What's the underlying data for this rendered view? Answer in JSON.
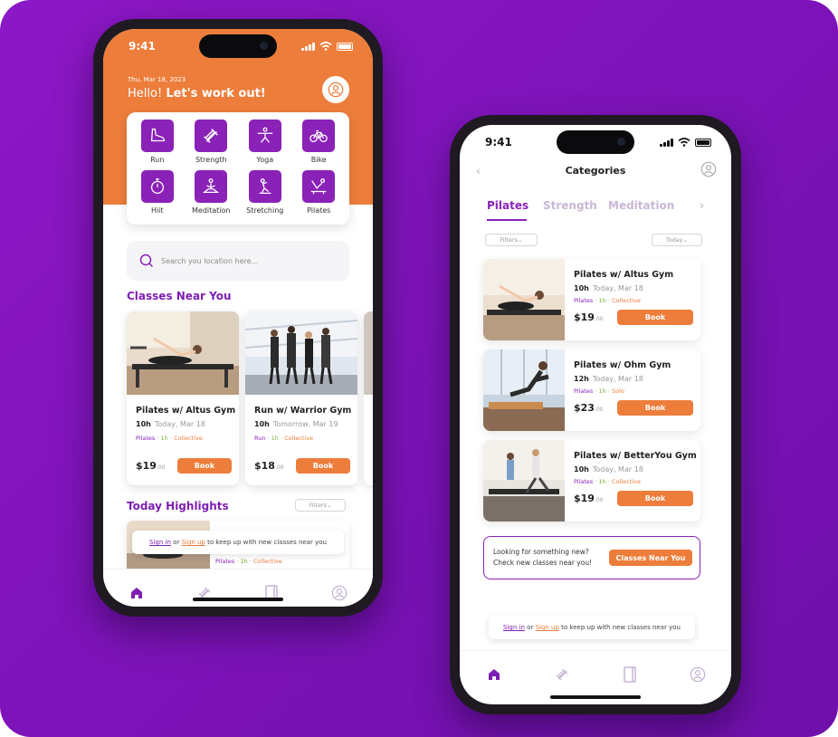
{
  "colors": {
    "brand_purple": "#8a22b8",
    "accent_orange": "#ed7d3b",
    "background": "#7d13b8"
  },
  "left_phone": {
    "status_time": "9:41",
    "date": "Thu, Mar 18, 2023",
    "greeting_prefix": "Hello!",
    "greeting_bold": "Let's work out!",
    "categories": [
      {
        "label": "Run",
        "icon": "run-shoe-icon"
      },
      {
        "label": "Strength",
        "icon": "dumbbell-icon"
      },
      {
        "label": "Yoga",
        "icon": "yoga-icon"
      },
      {
        "label": "Bike",
        "icon": "bike-icon"
      },
      {
        "label": "Hiit",
        "icon": "stopwatch-icon"
      },
      {
        "label": "Meditation",
        "icon": "meditation-icon"
      },
      {
        "label": "Stretching",
        "icon": "stretching-icon"
      },
      {
        "label": "Pilates",
        "icon": "pilates-icon"
      }
    ],
    "search_placeholder": "Search you location here...",
    "classes_title": "Classes Near You",
    "classes": [
      {
        "title": "Pilates w/ Altus Gym",
        "time": "10h",
        "day": "Today, Mar 18",
        "tag1": "Pilates",
        "tag2": "1h",
        "tag3": "Collective",
        "price": "$19",
        "cents": ".00",
        "book": "Book"
      },
      {
        "title": "Run w/ Warrior Gym",
        "time": "10h",
        "day": "Tomorrow, Mar 19",
        "tag1": "Run",
        "tag2": "1h",
        "tag3": "Collective",
        "price": "$18",
        "cents": ".00",
        "book": "Book"
      }
    ],
    "highlights_title": "Today Highlights",
    "filters": "Filters",
    "signin_prefix": "Sign in",
    "signin_or": "or",
    "signup": "Sign up",
    "signin_suffix": "to keep up with new classes near you",
    "peek_tags": {
      "tag1": "Pilates",
      "tag2": "1h",
      "tag3": "Collective"
    },
    "tabs": [
      "home-icon",
      "dumbbell-icon",
      "book-icon",
      "profile-icon"
    ]
  },
  "right_phone": {
    "status_time": "9:41",
    "back": "‹",
    "title": "Categories",
    "tabs": [
      "Pilates",
      "Strength",
      "Meditation"
    ],
    "more": "›",
    "filters": "Filters",
    "today": "Today",
    "list": [
      {
        "title": "Pilates w/ Altus Gym",
        "time": "10h",
        "day": "Today, Mar 18",
        "tag1": "Pilates",
        "tag2": "1h",
        "tag3": "Collective",
        "price": "$19",
        "cents": ".00",
        "book": "Book"
      },
      {
        "title": "Pilates w/ Ohm Gym",
        "time": "12h",
        "day": "Today, Mar 18",
        "tag1": "Pilates",
        "tag2": "1h",
        "tag3": "Solo",
        "price": "$23",
        "cents": ".00",
        "book": "Book"
      },
      {
        "title": "Pilates w/ BetterYou Gym",
        "time": "10h",
        "day": "Today, Mar 18",
        "tag1": "Pilates",
        "tag2": "1h",
        "tag3": "Collective",
        "price": "$19",
        "cents": ".00",
        "book": "Book"
      }
    ],
    "looking_line1": "Looking for something new?",
    "looking_line2": "Check new classes near you!",
    "classes_near_btn": "Classes Near You",
    "signin_prefix": "Sign in",
    "signin_or": "or",
    "signup": "Sign up",
    "signin_suffix": "to keep up with new classes near you"
  }
}
